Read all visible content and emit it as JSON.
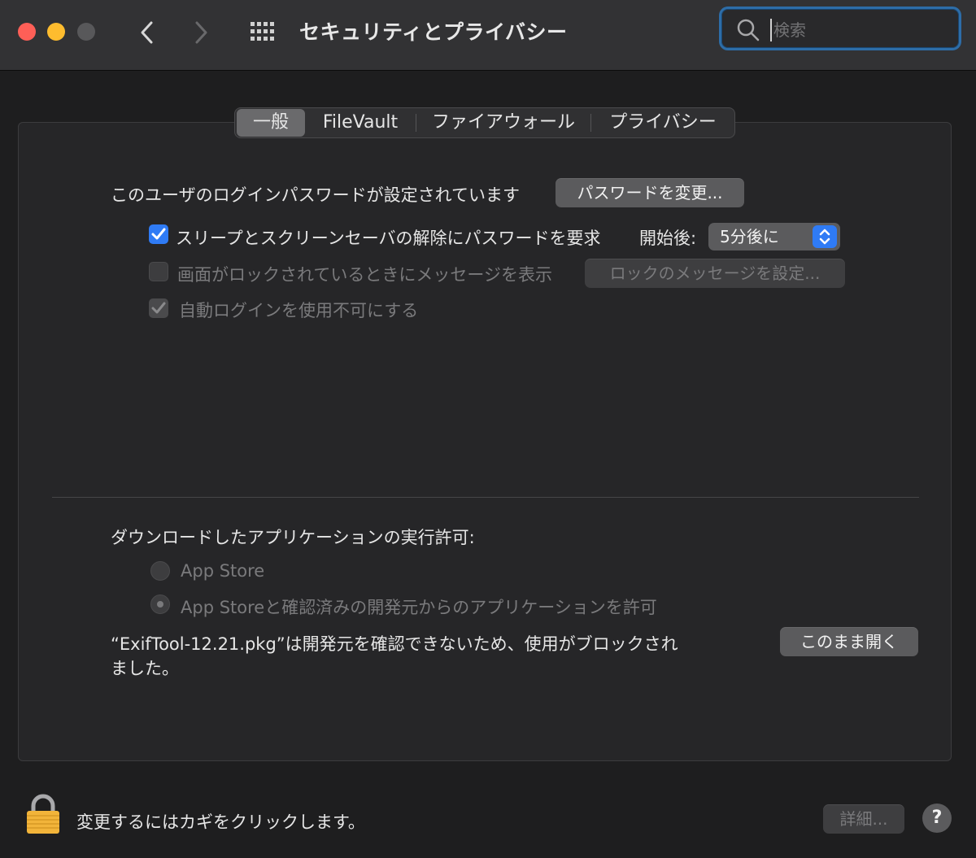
{
  "window": {
    "title": "セキュリティとプライバシー",
    "search_placeholder": "検索"
  },
  "tabs": [
    {
      "label": "一般",
      "active": true
    },
    {
      "label": "FileVault",
      "active": false
    },
    {
      "label": "ファイアウォール",
      "active": false
    },
    {
      "label": "プライバシー",
      "active": false
    }
  ],
  "general": {
    "password_label": "このユーザのログインパスワードが設定されています",
    "change_password_button": "パスワードを変更...",
    "require_password": {
      "label": "スリープとスクリーンセーバの解除にパスワードを要求",
      "checked": true,
      "after_label": "開始後:",
      "after_value": "5分後に"
    },
    "show_message": {
      "label": "画面がロックされているときにメッセージを表示",
      "checked": false,
      "enabled": false,
      "button": "ロックのメッセージを設定..."
    },
    "disable_autologin": {
      "label": "自動ログインを使用不可にする",
      "checked": true,
      "enabled": false
    },
    "downloads": {
      "heading": "ダウンロードしたアプリケーションの実行許可:",
      "options": [
        {
          "label": "App Store",
          "selected": false
        },
        {
          "label": "App Storeと確認済みの開発元からのアプリケーションを許可",
          "selected": true
        }
      ],
      "blocked_line1": "“ExifTool-12.21.pkg”は開発元を確認できないため、使用がブロックされ",
      "blocked_line2": "ました。",
      "open_anyway_button": "このまま開く"
    }
  },
  "footer": {
    "lock_text": "変更するにはカギをクリックします。",
    "advanced_button": "詳細...",
    "help_label": "?"
  },
  "colors": {
    "accent": "#2f7bf5",
    "search_focus": "#2d6da8",
    "close": "#fe5f57",
    "minimize": "#febc2e"
  }
}
